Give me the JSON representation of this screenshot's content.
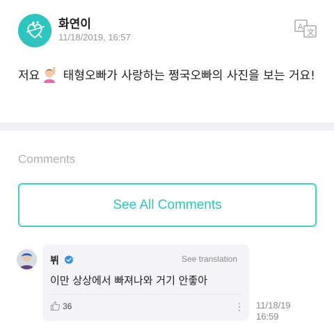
{
  "post": {
    "author_name": "화연이",
    "timestamp": "11/18/2019, 16:57",
    "body_before_emoji": "저요",
    "body_after_emoji": " 태형오빠가 사랑하는 쩡국오빠의 사진을 보는 거요!"
  },
  "comments": {
    "section_title": "Comments",
    "see_all_label": "See All Comments",
    "items": [
      {
        "author": "뷔",
        "verified": true,
        "translate_label": "See translation",
        "text": "이만 상상에서 빠져나와 거기 안좋아",
        "likes": "36",
        "date": "11/18/19",
        "time": "16:59"
      }
    ]
  },
  "colors": {
    "accent": "#3fd3c6",
    "accent_text": "#2cc9ba",
    "verified": "#2f8fe0",
    "avatar_teal": "#2ec4c0",
    "muted": "#b0b0b0"
  },
  "icons": {
    "translate": "translate-icon",
    "verified": "verified-badge-icon",
    "like": "thumbs-up-icon",
    "more": "more-vertical-icon",
    "emoji": "raising-hand-emoji"
  }
}
